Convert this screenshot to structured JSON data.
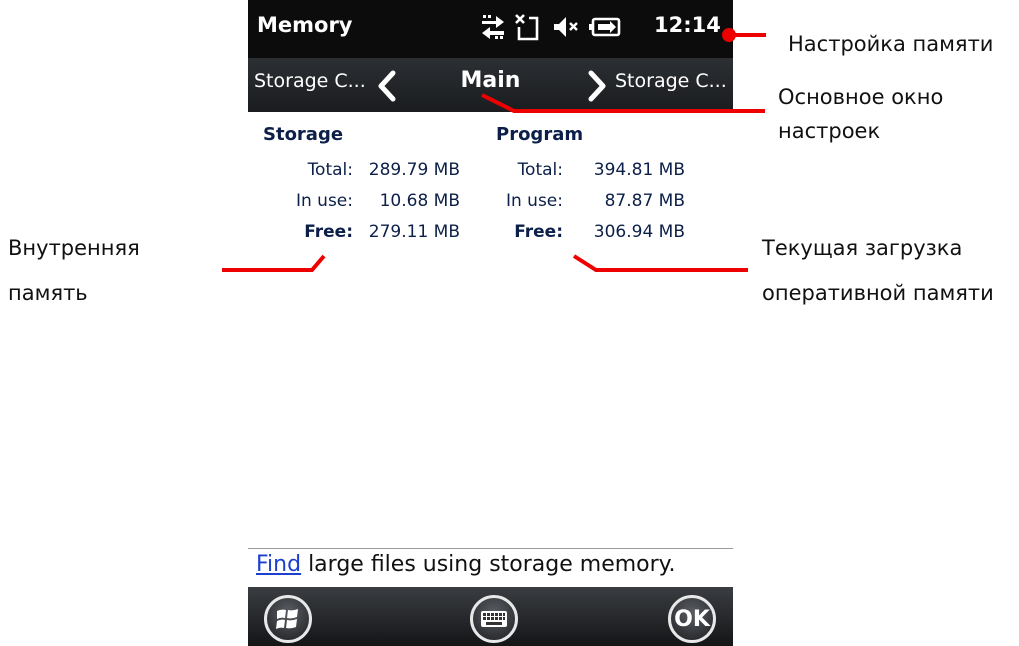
{
  "status_bar": {
    "app_title": "Memory",
    "time": "12:14",
    "icons": [
      "sync-arrows-icon",
      "no-sim-icon",
      "speaker-muted-icon",
      "battery-charging-icon"
    ]
  },
  "tabs": {
    "previous": "Storage C...",
    "current": "Main",
    "next": "Storage C..."
  },
  "storage": {
    "heading": "Storage",
    "total_label": "Total:",
    "total_value": "289.79 MB",
    "in_use_label": "In use:",
    "in_use_value": "10.68 MB",
    "free_label": "Free:",
    "free_value": "279.11 MB"
  },
  "program": {
    "heading": "Program",
    "total_label": "Total:",
    "total_value": "394.81 MB",
    "in_use_label": "In use:",
    "in_use_value": "87.87 MB",
    "free_label": "Free:",
    "free_value": "306.94 MB"
  },
  "footer": {
    "link": "Find",
    "text": " large files using storage memory."
  },
  "softkeys": {
    "ok": "OK",
    "icons": [
      "windows-start-icon",
      "keyboard-icon"
    ]
  },
  "annotations": {
    "memory_settings": "Настройка памяти",
    "main_window_line1": "Основное окно",
    "main_window_line2": "настроек",
    "internal_memory_line1": "Внутренняя",
    "internal_memory_line2": "память",
    "ram_load_line1": "Текущая загрузка",
    "ram_load_line2": "оперативной памяти"
  },
  "colors": {
    "annotation_line": "#ee0000",
    "text_dark_blue": "#0c1f49",
    "link_blue": "#1c3fd0",
    "status_bar_bg": "#0c0c0c"
  }
}
